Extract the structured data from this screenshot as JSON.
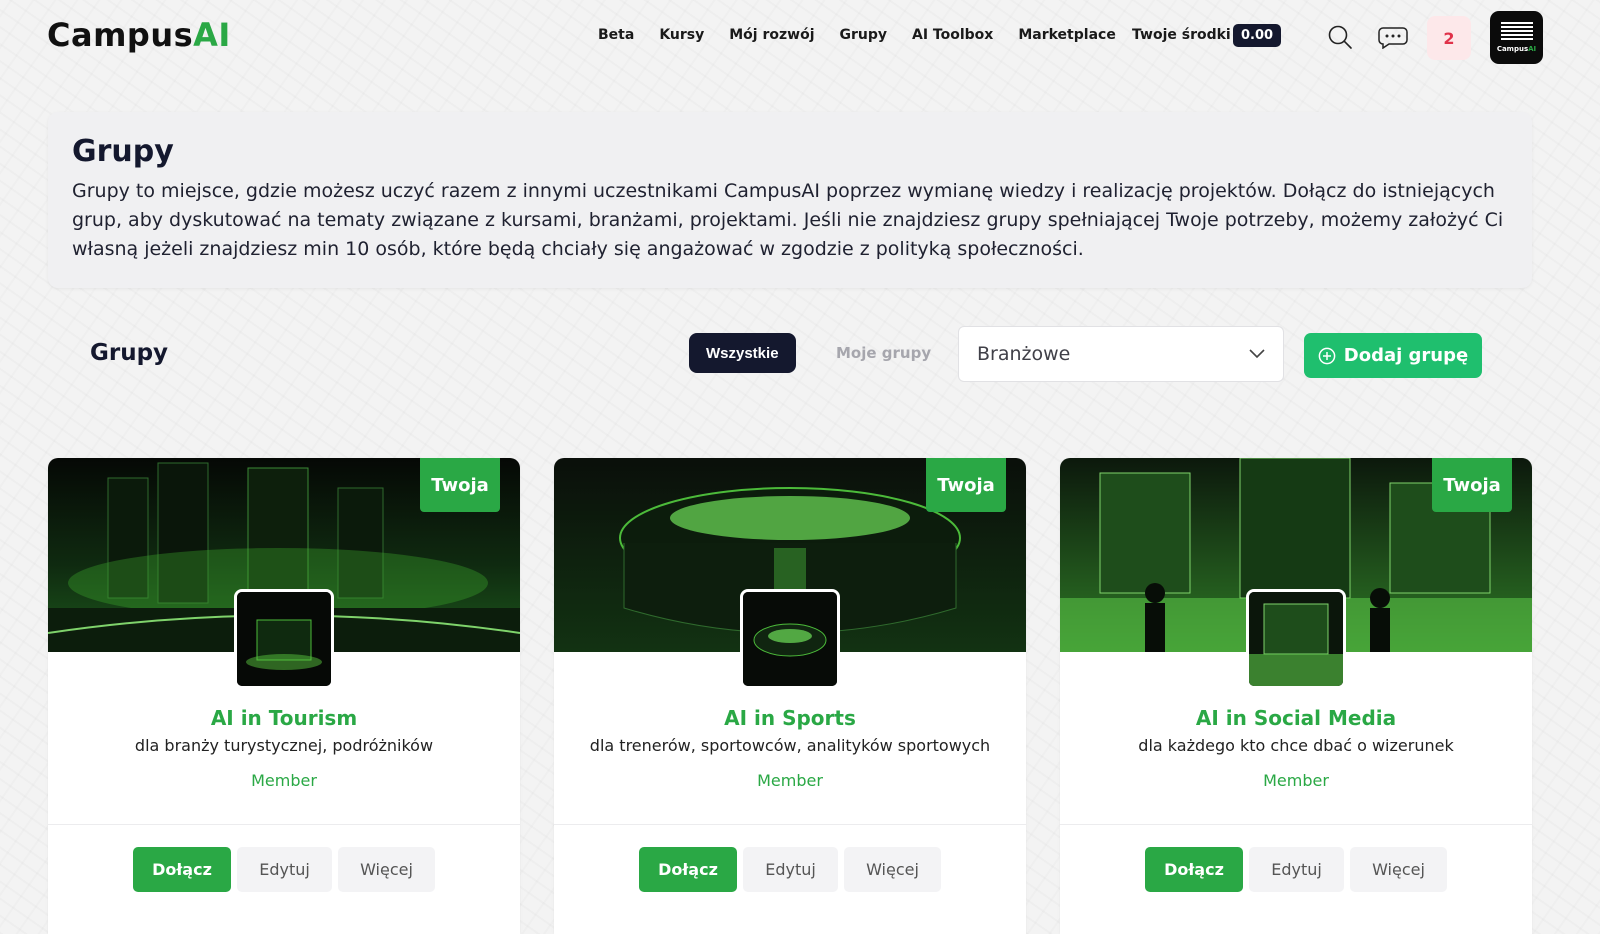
{
  "header": {
    "logo_text": "Campus",
    "logo_accent": "AI",
    "nav": [
      "Beta",
      "Kursy",
      "Mój rozwój",
      "Grupy",
      "AI Toolbox",
      "Marketplace"
    ],
    "funds_label": "Twoje środki",
    "funds_value": "0.00",
    "notifications_count": "2",
    "avatar_text": "Campus",
    "avatar_accent": "AI"
  },
  "intro": {
    "title": "Grupy",
    "text": "Grupy to miejsce, gdzie możesz uczyć razem z innymi uczestnikami CampusAI poprzez wymianę wiedzy i realizację projektów. Dołącz do istniejących grup, aby dyskutować na tematy związane z kursami, branżami, projektami. Jeśli nie znajdziesz grupy spełniającej Twoje potrzeby, możemy założyć Ci własną jeżeli znajdziesz min 10 osób, które będą chciały się angażować w zgodzie z polityką społeczności."
  },
  "toolbar": {
    "title": "Grupy",
    "tab_all": "Wszystkie",
    "tab_mine": "Moje grupy",
    "filter_value": "Branżowe",
    "add_label": "Dodaj grupę"
  },
  "cards": [
    {
      "tag": "Twoja",
      "title": "AI in Tourism",
      "subtitle": "dla branży turystycznej, podróżników",
      "role": "Member",
      "join": "Dołącz",
      "edit": "Edytuj",
      "more": "Więcej"
    },
    {
      "tag": "Twoja",
      "title": "AI in Sports",
      "subtitle": "dla trenerów, sportowców, analityków sportowych",
      "role": "Member",
      "join": "Dołącz",
      "edit": "Edytuj",
      "more": "Więcej"
    },
    {
      "tag": "Twoja",
      "title": "AI in Social Media",
      "subtitle": "dla każdego kto chce dbać o wizerunek",
      "role": "Member",
      "join": "Dołącz",
      "edit": "Edytuj",
      "more": "Więcej"
    }
  ],
  "colors": {
    "accent": "#2aa845",
    "dark": "#14182e",
    "add_button": "#1fbf6e",
    "notif_bg": "#fde8ea",
    "notif_text": "#e0324a"
  }
}
